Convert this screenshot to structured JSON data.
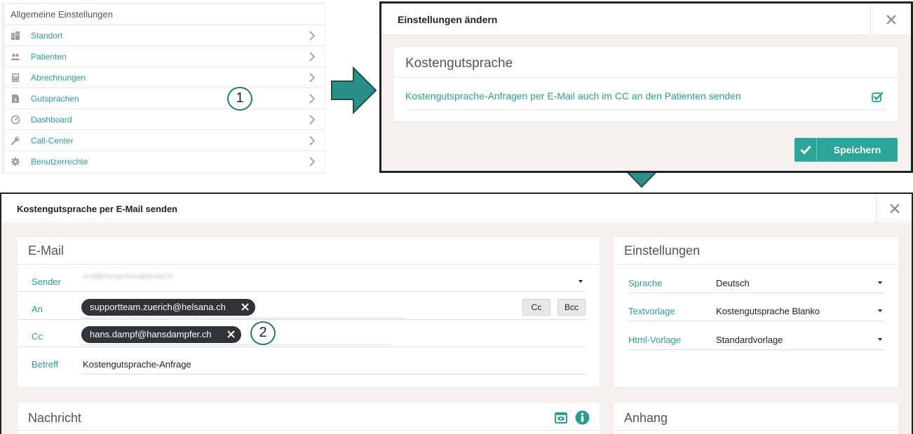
{
  "settings_list": {
    "title": "Allgemeine Einstellungen",
    "items": [
      {
        "label": "Standort",
        "icon": "building-icon"
      },
      {
        "label": "Patienten",
        "icon": "users-icon"
      },
      {
        "label": "Abrechnungen",
        "icon": "calculator-icon"
      },
      {
        "label": "Gutsprachen",
        "icon": "document-dollar-icon"
      },
      {
        "label": "Dashboard",
        "icon": "dashboard-icon"
      },
      {
        "label": "Call-Center",
        "icon": "wrench-icon"
      },
      {
        "label": "Benutzerrechte",
        "icon": "gear-icon"
      }
    ]
  },
  "markers": {
    "one": "1",
    "two": "2"
  },
  "modal_settings": {
    "title": "Einstellungen ändern",
    "panel_title": "Kostengutsprache",
    "option_text": "Kostengutsprache-Anfragen per E-Mail auch im CC an den Patienten senden",
    "option_checked": true,
    "save_label": "Speichern"
  },
  "modal_email": {
    "title": "Kostengutsprache per E-Mail senden",
    "email_panel": {
      "title": "E-Mail",
      "sender_label": "Sender",
      "sender_value": "andi@compa.therapiemail.ch",
      "to_label": "An",
      "to_tags": [
        "supportteam.zuerich@helsana.ch"
      ],
      "cc_button": "Cc",
      "bcc_button": "Bcc",
      "cc_label": "Cc",
      "cc_tags": [
        "hans.dampf@hansdampfer.ch"
      ],
      "subject_label": "Betreff",
      "subject_value": "Kostengutsprache-Anfrage"
    },
    "settings_panel": {
      "title": "Einstellungen",
      "language_label": "Sprache",
      "language_value": "Deutsch",
      "template_label": "Textvorlage",
      "template_value": "Kostengutsprache Blanko",
      "html_label": "Html-Vorlage",
      "html_value": "Standardvorlage"
    },
    "message_panel": {
      "title": "Nachricht"
    },
    "attachment_panel": {
      "title": "Anhang"
    }
  },
  "colors": {
    "accent": "#2aa69b",
    "link": "#2a9d8f",
    "arrow": "#2a8f86",
    "tag": "#2f3438"
  }
}
